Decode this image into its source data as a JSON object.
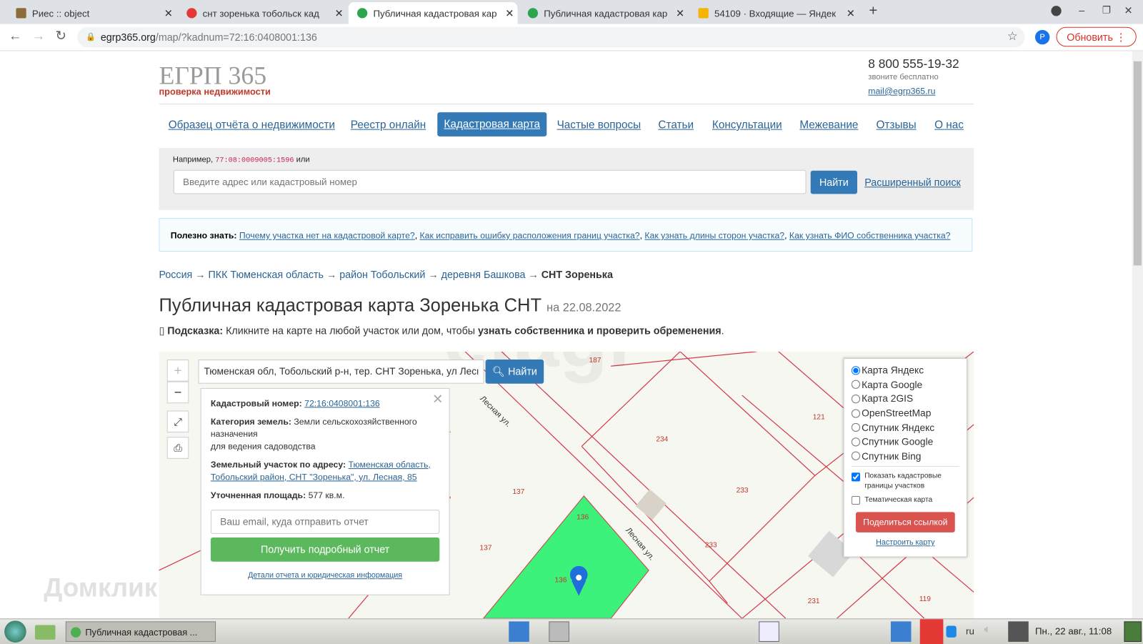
{
  "browser": {
    "tabs": [
      {
        "title": "Риес :: object",
        "color": "#8e6b3a"
      },
      {
        "title": "снт зоренька тобольск кад",
        "color": "#e53935"
      },
      {
        "title": "Публичная кадастровая кар",
        "color": "#2da44e",
        "active": true
      },
      {
        "title": "Публичная кадастровая кар",
        "color": "#2da44e"
      },
      {
        "title": "54109 · Входящие — Яндек",
        "color": "#f4b400"
      }
    ],
    "new_tab": "+",
    "url_host": "egrp365.org",
    "url_path": "/map/?kadnum=72:16:0408001:136",
    "profile": "P",
    "update_label": "Обновить"
  },
  "site": {
    "logo": "ЕГРП 365",
    "logo_sub": "проверка недвижимости",
    "phone": "8 800 555-19-32",
    "phone_note": "звоните бесплатно",
    "email": "mail@egrp365.ru",
    "menu": [
      "Образец отчёта о недвижимости",
      "Реестр онлайн",
      "Кадастровая карта",
      "Частые вопросы",
      "Статьи",
      "Консультации",
      "Межевание",
      "Отзывы",
      "О нас"
    ],
    "search": {
      "example_prefix": "Например,",
      "example_code": "77:08:0009005:1596",
      "example_suffix": "или",
      "placeholder": "Введите адрес или кадастровый номер",
      "button": "Найти",
      "advanced": "Расширенный поиск"
    },
    "hint": {
      "label": "Полезно знать:",
      "links": [
        "Почему участка нет на кадастровой карте?",
        "Как исправить ошибку расположения границ участка?",
        "Как узнать длины сторон участка?",
        "Как узнать ФИО собственника участка?"
      ]
    },
    "breadcrumb": [
      "Россия",
      "ПКК Тюменская область",
      "район Тобольский",
      "деревня Башкова"
    ],
    "breadcrumb_current": "СНТ Зоренька",
    "arrow": "→",
    "title": "Публичная кадастровая карта Зоренька СНТ",
    "title_date": "на 22.08.2022",
    "tip_label": "Подсказка:",
    "tip_text": "Кликните на карте на любой участок или дом, чтобы",
    "tip_bold": "узнать собственника и проверить обременения",
    "tip_end": "."
  },
  "map": {
    "search_value": "Тюменская обл, Тобольский р-н, тер. СНТ Зоренька, ул Лесная",
    "search_button": "Найти",
    "popup": {
      "kad_label": "Кадастровый номер:",
      "kad_value": "72:16:0408001:136",
      "cat_label": "Категория земель:",
      "cat_value": "Земли сельскохозяйственного назначения",
      "cat_use": "для ведения садоводства",
      "addr_label": "Земельный участок по адресу:",
      "addr_value": "Тюменская область, Тобольский район, СНТ \"Зоренька\", ул. Лесная, 85",
      "area_label": "Уточненная площадь:",
      "area_value": "577 кв.м.",
      "email_placeholder": "Ваш email, куда отправить отчет",
      "report_button": "Получить подробный отчет",
      "details_link": "Детали отчета и юридическая информация"
    },
    "layers": [
      "Карта Яндекс",
      "Карта Google",
      "Карта 2GIS",
      "OpenStreetMap",
      "Спутник Яндекс",
      "Спутник Google",
      "Спутник Bing"
    ],
    "selected_layer": "Карта Яндекс",
    "show_borders": "Показать кадастровые границы участков",
    "thematic": "Тематическая карта",
    "share_button": "Поделиться ссылкой",
    "configure": "Настроить карту",
    "street": "Лесная ул.",
    "plots": [
      "187",
      "234",
      "121",
      "233",
      "137",
      "136",
      "233",
      "231",
      "119",
      "137",
      "136"
    ],
    "watermark": "etagi",
    "highlight_color": "#3df27a"
  },
  "taskbar": {
    "active_window": "Публичная кадастровая ...",
    "lang": "ru",
    "clock": "Пн., 22 авг., 11:08"
  },
  "overlay": {
    "watermark": "Домклик"
  }
}
